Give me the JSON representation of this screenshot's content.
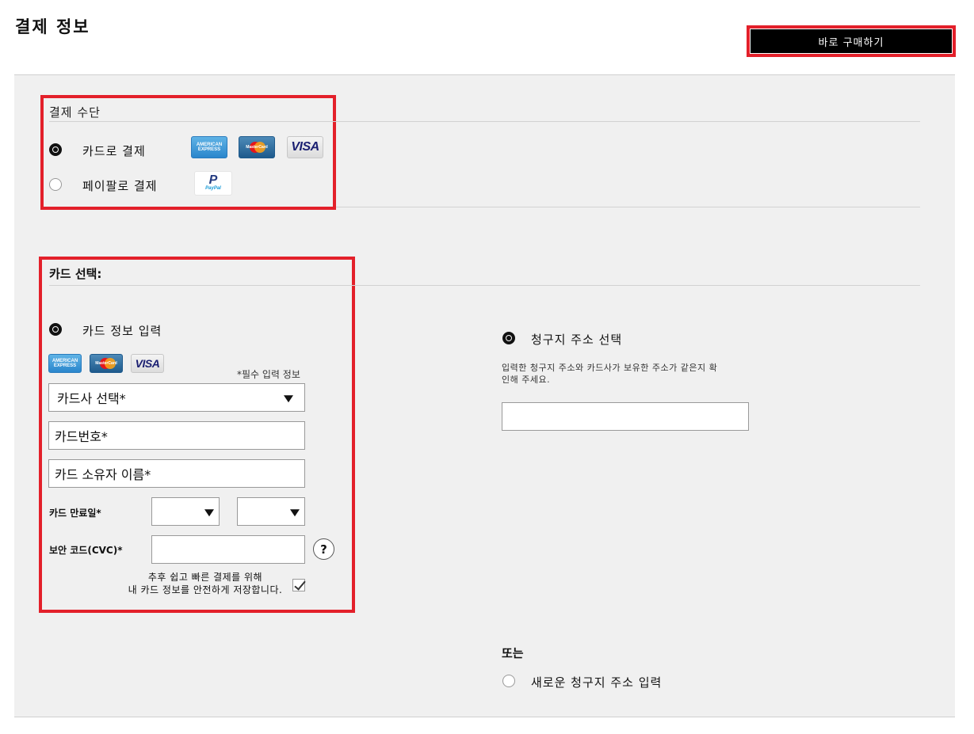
{
  "page": {
    "title": "결제 정보"
  },
  "header": {
    "buy_now_label": "바로 구매하기"
  },
  "payment_method": {
    "heading": "결제 수단",
    "options": [
      {
        "label": "카드로 결제",
        "selected": true,
        "logos": [
          "amex-logo",
          "mastercard-logo",
          "visa-logo"
        ]
      },
      {
        "label": "페이팔로 결제",
        "selected": false,
        "logos": [
          "paypal-logo"
        ]
      }
    ]
  },
  "logos": {
    "amex_text": "AMERICAN EXPRESS",
    "mastercard_text": "MasterCard",
    "visa_text": "VISA",
    "paypal_text": "PayPal",
    "paypal_letter": "P"
  },
  "card_select": {
    "heading": "카드 선택:",
    "enter_card_label": "카드 정보 입력",
    "required_note": "*필수 입력 정보",
    "issuer_select": {
      "value": "카드사 선택*"
    },
    "card_number": {
      "placeholder": "카드번호*"
    },
    "holder_name": {
      "placeholder": "카드 소유자 이름*"
    },
    "expiry_label": "카드 만료일*",
    "expiry_month": {
      "value": ""
    },
    "expiry_year": {
      "value": ""
    },
    "cvc_label": "보안 코드(CVC)*",
    "cvc": {
      "value": ""
    },
    "help_symbol": "?",
    "save_line1": "추후 쉽고 빠른 결제를 위해",
    "save_line2": "내 카드 정보를 안전하게 저장합니다.",
    "save_checked": true
  },
  "billing": {
    "select_label": "청구지 주소 선택",
    "info_line1": "입력한 청구지 주소와 카드사가 보유한 주소가 같은지 확",
    "info_line2": "인해 주세요.",
    "address_value": "",
    "or_label": "또는",
    "new_address_label": "새로운 청구지 주소 입력"
  },
  "colors": {
    "highlight": "#e3202a",
    "panel_bg": "#f0f0f0",
    "button_bg": "#000000"
  }
}
